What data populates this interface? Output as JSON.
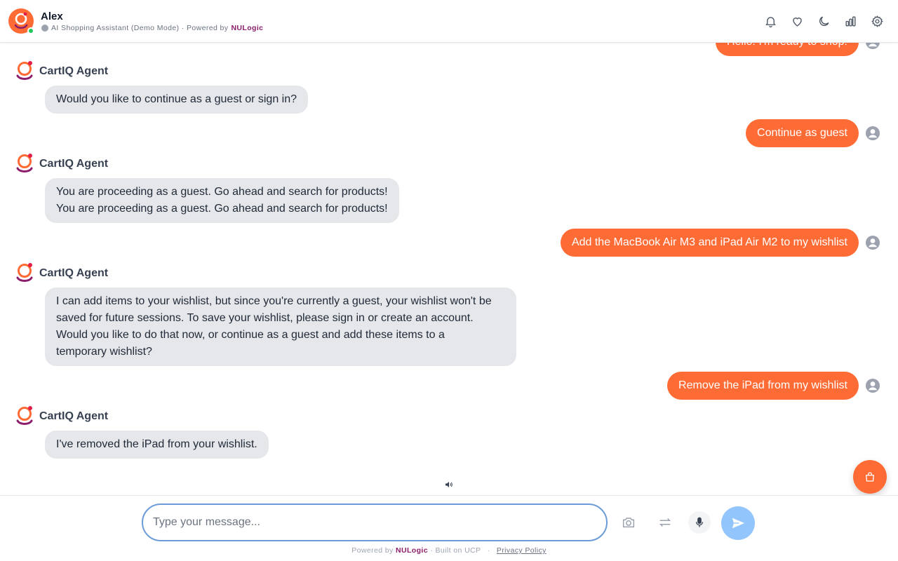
{
  "header": {
    "name": "Alex",
    "subtitle": "AI Shopping Assistant (Demo Mode) · Powered by",
    "brand": "NULogic",
    "icons": [
      "bell-icon",
      "heart-icon",
      "moon-icon",
      "chart-icon",
      "gear-icon"
    ]
  },
  "messages": [
    {
      "role": "user",
      "text": "Hello! I'm ready to shop!"
    },
    {
      "role": "agent",
      "sender": "CartIQ Agent",
      "lines": [
        "Would you like to continue as a guest or sign in?"
      ]
    },
    {
      "role": "user",
      "text": "Continue as guest"
    },
    {
      "role": "agent",
      "sender": "CartIQ Agent",
      "lines": [
        "You are proceeding as a guest. Go ahead and search for products!",
        "You are proceeding as a guest. Go ahead and search for products!"
      ]
    },
    {
      "role": "user",
      "text": "Add the MacBook Air M3 and iPad Air M2 to my wishlist"
    },
    {
      "role": "agent",
      "sender": "CartIQ Agent",
      "lines": [
        "I can add items to your wishlist, but since you're currently a guest, your wishlist won't be",
        "saved for future sessions. To save your wishlist, please sign in or create an account.",
        "Would you like to do that now, or continue as a guest and add these items to a",
        "temporary wishlist?"
      ]
    },
    {
      "role": "user",
      "text": "Remove the iPad from my wishlist"
    },
    {
      "role": "agent",
      "sender": "CartIQ Agent",
      "lines": [
        "I've removed the iPad from your wishlist."
      ]
    }
  ],
  "composer": {
    "placeholder": "Type your message...",
    "value": ""
  },
  "footer": {
    "powered": "Powered by",
    "brand": "NULogic",
    "built": "· Built on UCP",
    "dot": "·",
    "privacy": "Privacy Policy"
  },
  "colors": {
    "accent": "#ff6b35",
    "brand": "#8b1d6b",
    "agent_bubble": "#e5e7eb",
    "send_button": "#93c5fd",
    "input_border": "#6b9bd8"
  }
}
